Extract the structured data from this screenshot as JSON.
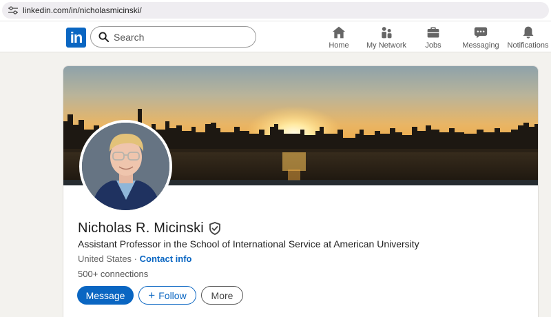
{
  "browser": {
    "url": "linkedin.com/in/nicholasmicinski/",
    "site_info_icon": "tune-icon"
  },
  "nav": {
    "logo_text": "in",
    "search_placeholder": "Search",
    "items": [
      {
        "label": "Home",
        "icon": "home-icon"
      },
      {
        "label": "My Network",
        "icon": "network-icon"
      },
      {
        "label": "Jobs",
        "icon": "briefcase-icon"
      },
      {
        "label": "Messaging",
        "icon": "chat-icon"
      },
      {
        "label": "Notifications",
        "icon": "bell-icon"
      }
    ]
  },
  "profile": {
    "name": "Nicholas R. Micinski",
    "headline": "Assistant Professor in the School of International Service at American University",
    "location": "United States",
    "separator": "·",
    "contact_label": "Contact info",
    "connections": "500+ connections",
    "actions": {
      "message": "Message",
      "follow": "Follow",
      "follow_icon": "+",
      "more": "More"
    }
  },
  "colors": {
    "brand": "#0a66c2",
    "page_bg": "#f3f2ee"
  }
}
